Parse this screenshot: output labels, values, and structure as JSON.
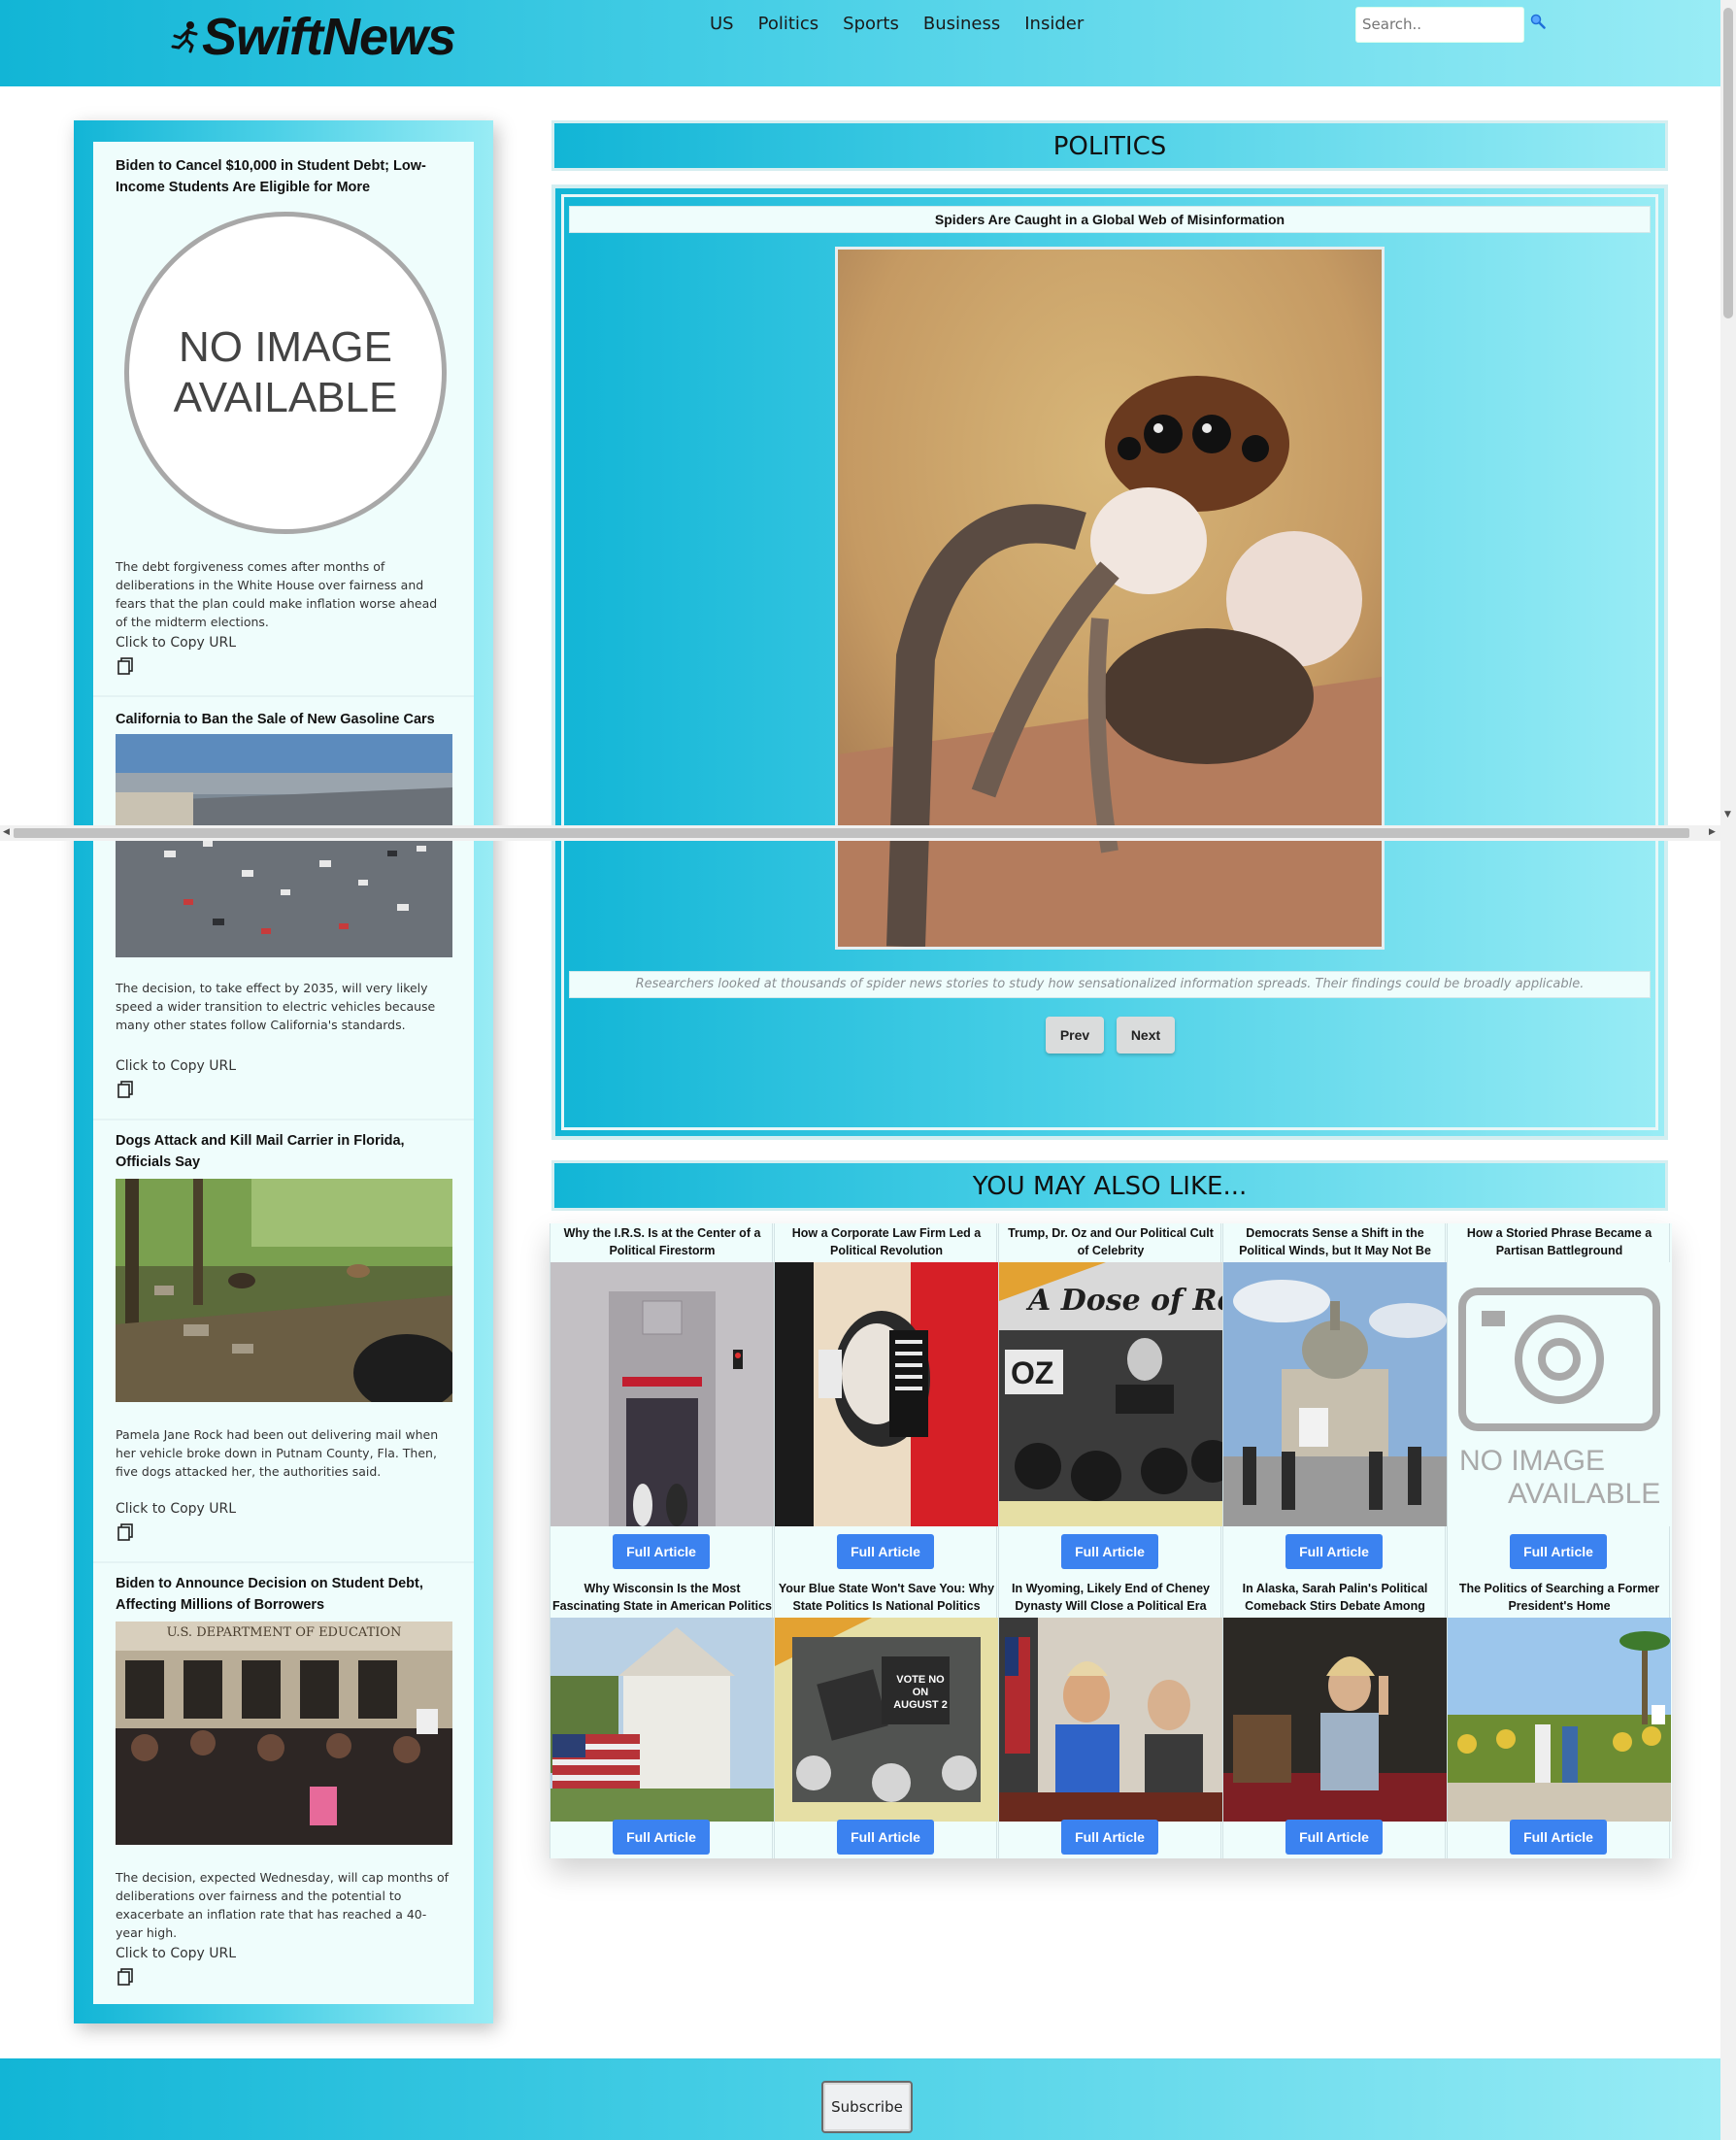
{
  "header": {
    "brand": "SwiftNews",
    "nav": [
      "US",
      "Politics",
      "Sports",
      "Business",
      "Insider"
    ],
    "search_placeholder": "Search.."
  },
  "sidebar": {
    "articles": [
      {
        "title": "Biden to Cancel $10,000 in Student Debt; Low-Income Students Are Eligible for More",
        "image": "no-image-available",
        "no_image_text": "NO IMAGE AVAILABLE",
        "description": "The debt forgiveness comes after months of deliberations in the White House over fairness and fears that the plan could make inflation worse ahead of the midterm elections.",
        "copy_label": "Click to Copy URL"
      },
      {
        "title": "California to Ban the Sale of New Gasoline Cars",
        "image": "highway-traffic-photo",
        "description": "The decision, to take effect by 2035, will very likely speed a wider transition to electric vehicles because many other states follow California's standards.",
        "copy_label": "Click to Copy URL"
      },
      {
        "title": "Dogs Attack and Kill Mail Carrier in Florida, Officials Say",
        "image": "dogs-in-field-photo",
        "description": "Pamela Jane Rock had been out delivering mail when her vehicle broke down in Putnam County, Fla. Then, five dogs attacked her, the authorities said.",
        "copy_label": "Click to Copy URL"
      },
      {
        "title": "Biden to Announce Decision on Student Debt, Affecting Millions of Borrowers",
        "image": "department-of-education-protest-photo",
        "sign_text": "U.S. DEPARTMENT OF EDUCATION",
        "description": "The decision, expected Wednesday, will cap months of deliberations over fairness and the potential to exacerbate an inflation rate that has reached a 40-year high.",
        "copy_label": "Click to Copy URL"
      }
    ]
  },
  "politics": {
    "heading": "POLITICS",
    "featured_title": "Spiders Are Caught in a Global Web of Misinformation",
    "featured_caption": "Researchers looked at thousands of spider news stories to study how sensationalized information spreads. Their findings could be broadly applicable.",
    "prev_label": "Prev",
    "next_label": "Next"
  },
  "also_like": {
    "heading": "YOU MAY ALSO LIKE...",
    "button_label": "Full Article",
    "row1": [
      {
        "title": "Why the I.R.S. Is at the Center of a Political Firestorm",
        "image": "irs-building-photo"
      },
      {
        "title": "How a Corporate Law Firm Led a Political Revolution",
        "image": "portrait-collage-illustration"
      },
      {
        "title": "Trump, Dr. Oz and Our Political Cult of Celebrity",
        "image": "oz-rally-photo",
        "banner_text": "A Dose of Rea",
        "sign_text": "OZ"
      },
      {
        "title": "Democrats Sense a Shift in the Political Winds, but It May Not Be Enough",
        "image": "capitol-protest-photo"
      },
      {
        "title": "How a Storied Phrase Became a Partisan Battleground",
        "image": "no-image-camera",
        "no_image_text_1": "NO IMAGE",
        "no_image_text_2": "AVAILABLE"
      }
    ],
    "row2": [
      {
        "title": "Why Wisconsin Is the Most Fascinating State in American Politics",
        "image": "flag-house-photo"
      },
      {
        "title": "Your Blue State Won't Save You: Why State Politics Is National Politics",
        "image": "vote-no-signs-photo",
        "sign_text": "VOTE NO ON AUGUST 2"
      },
      {
        "title": "In Wyoming, Likely End of Cheney Dynasty Will Close a Political Era",
        "image": "hearing-room-photo"
      },
      {
        "title": "In Alaska, Sarah Palin's Political Comeback Stirs Debate Among Voters",
        "image": "podium-speaker-photo"
      },
      {
        "title": "The Politics of Searching a Former President's Home",
        "image": "palm-trees-protest-photo"
      }
    ]
  },
  "footer": {
    "subscribe_label": "Subscribe"
  },
  "colors": {
    "gradient_start": "#12b5d6",
    "gradient_end": "#99ecf5",
    "card_bg": "#effdfc",
    "button_blue": "#3b82f0"
  }
}
